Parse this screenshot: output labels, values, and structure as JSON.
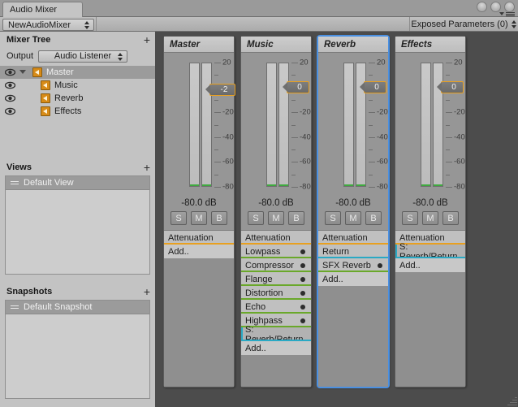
{
  "window": {
    "tab_label": "Audio Mixer",
    "buttons": [
      "minimize",
      "maximize",
      "close"
    ],
    "menu_icon": "hamburger-menu-icon"
  },
  "toolbar": {
    "mixer_name": "NewAudioMixer",
    "exposed_parameters": "Exposed Parameters (0)"
  },
  "sidebar": {
    "mixer_tree": {
      "title": "Mixer Tree",
      "add_label": "+",
      "output_label": "Output",
      "output_value": "Audio Listener",
      "groups": [
        {
          "name": "Master",
          "selected": true,
          "indent": 0,
          "expanded": true
        },
        {
          "name": "Music",
          "selected": false,
          "indent": 1,
          "expanded": false
        },
        {
          "name": "Reverb",
          "selected": false,
          "indent": 1,
          "expanded": false
        },
        {
          "name": "Effects",
          "selected": false,
          "indent": 1,
          "expanded": false
        }
      ]
    },
    "views": {
      "title": "Views",
      "add_label": "+",
      "items": [
        {
          "name": "Default View"
        }
      ]
    },
    "snapshots": {
      "title": "Snapshots",
      "add_label": "+",
      "items": [
        {
          "name": "Default Snapshot"
        }
      ]
    }
  },
  "mixer": {
    "scale_labels": [
      "20",
      "0",
      "-20",
      "-40",
      "-60",
      "-80"
    ],
    "strips": [
      {
        "name": "Master",
        "selected": false,
        "fader_value": "-2",
        "db_readout": "-80.0 dB",
        "solo": "S",
        "mute": "M",
        "bypass": "B",
        "effects": [
          {
            "label": "Attenuation",
            "type": "attenuation",
            "underline": "#e8a020",
            "bypass_dot": false
          },
          {
            "label": "Add..",
            "type": "add",
            "underline": "none",
            "bypass_dot": false
          }
        ]
      },
      {
        "name": "Music",
        "selected": false,
        "fader_value": "0",
        "db_readout": "-80.0 dB",
        "solo": "S",
        "mute": "M",
        "bypass": "B",
        "effects": [
          {
            "label": "Attenuation",
            "type": "attenuation",
            "underline": "#e8a020",
            "bypass_dot": false
          },
          {
            "label": "Lowpass",
            "type": "effect",
            "underline": "#6aa82a",
            "bypass_dot": true
          },
          {
            "label": "Compressor",
            "type": "effect",
            "underline": "#6aa82a",
            "bypass_dot": true
          },
          {
            "label": "Flange",
            "type": "effect",
            "underline": "#6aa82a",
            "bypass_dot": true
          },
          {
            "label": "Distortion",
            "type": "effect",
            "underline": "#6aa82a",
            "bypass_dot": true
          },
          {
            "label": "Echo",
            "type": "effect",
            "underline": "#6aa82a",
            "bypass_dot": true
          },
          {
            "label": "Highpass",
            "type": "effect",
            "underline": "#6aa82a",
            "bypass_dot": true
          },
          {
            "label": "S: Reverb/Return",
            "type": "send",
            "underline": "#2aa9c4",
            "bypass_dot": false
          },
          {
            "label": "Add..",
            "type": "add",
            "underline": "none",
            "bypass_dot": false
          }
        ]
      },
      {
        "name": "Reverb",
        "selected": true,
        "fader_value": "0",
        "db_readout": "-80.0 dB",
        "solo": "S",
        "mute": "M",
        "bypass": "B",
        "effects": [
          {
            "label": "Attenuation",
            "type": "attenuation",
            "underline": "#e8a020",
            "bypass_dot": false
          },
          {
            "label": "Return",
            "type": "return",
            "underline": "#2aa9c4",
            "bypass_dot": false
          },
          {
            "label": "SFX Reverb",
            "type": "effect",
            "underline": "#6aa82a",
            "bypass_dot": true
          },
          {
            "label": "Add..",
            "type": "add",
            "underline": "none",
            "bypass_dot": false
          }
        ]
      },
      {
        "name": "Effects",
        "selected": false,
        "fader_value": "0",
        "db_readout": "-80.0 dB",
        "solo": "S",
        "mute": "M",
        "bypass": "B",
        "effects": [
          {
            "label": "Attenuation",
            "type": "attenuation",
            "underline": "#e8a020",
            "bypass_dot": false
          },
          {
            "label": "S: Reverb/Return",
            "type": "send",
            "underline": "#2aa9c4",
            "bypass_dot": false
          },
          {
            "label": "Add..",
            "type": "add",
            "underline": "none",
            "bypass_dot": false
          }
        ]
      }
    ]
  },
  "colors": {
    "accent_orange": "#e8a020",
    "effect_green": "#6aa82a",
    "send_cyan": "#2aa9c4",
    "selection_blue": "#4a90e2",
    "meter_level_green": "#3faa3f"
  }
}
